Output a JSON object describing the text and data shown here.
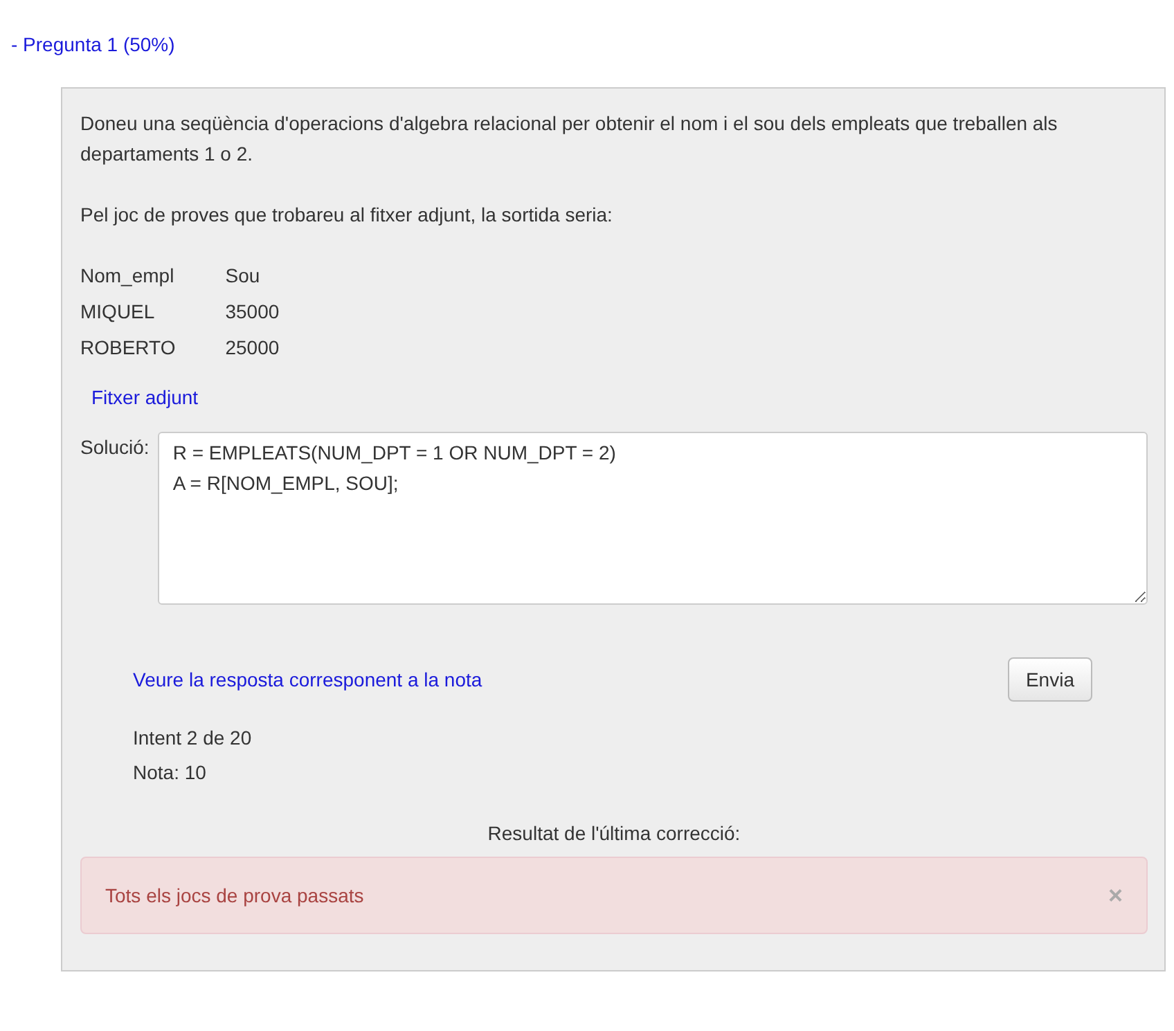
{
  "question_link": "- Pregunta 1 (50%)",
  "statement": "Doneu una seqüència d'operacions d'algebra relacional per obtenir el nom i el sou dels empleats que treballen als departaments 1 o 2.",
  "example_intro": "Pel joc de proves que trobareu al fitxer adjunt, la sortida seria:",
  "example_table": {
    "columns": [
      "Nom_empl",
      "Sou"
    ],
    "rows": [
      [
        "MIQUEL",
        "35000"
      ],
      [
        "ROBERTO",
        "25000"
      ]
    ]
  },
  "attachment_link": "Fitxer adjunt",
  "solution": {
    "label": "Solució:",
    "value": "R = EMPLEATS(NUM_DPT = 1 OR NUM_DPT = 2)\nA = R[NOM_EMPL, SOU];"
  },
  "answer_link": "Veure la resposta corresponent a la nota",
  "submit_button": "Envia",
  "attempt": "Intent 2 de 20",
  "grade": "Nota: 10",
  "result_heading": "Resultat de l'última correcció:",
  "alert": {
    "message": "Tots els jocs de prova passats",
    "close": "×"
  }
}
